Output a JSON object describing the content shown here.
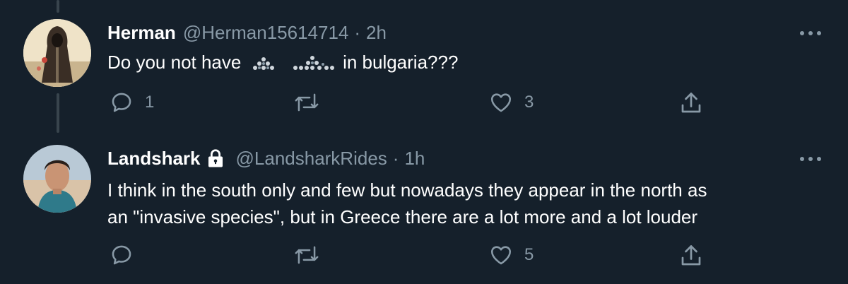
{
  "tweets": [
    {
      "name": "Herman",
      "handle": "@Herman15614714",
      "separator": "·",
      "time": "2h",
      "text_before": "Do you not have",
      "text_after": "in bulgaria???",
      "reply_count": "1",
      "retweet_count": "",
      "like_count": "3",
      "locked": false
    },
    {
      "name": "Landshark",
      "handle": "@LandsharkRides",
      "separator": "·",
      "time": "1h",
      "line1": "I think in the south only and few but nowadays they appear in the north as",
      "line2": "an \"invasive species\", but in Greece there are a lot more and a lot louder",
      "reply_count": "",
      "retweet_count": "",
      "like_count": "5",
      "locked": true
    }
  ],
  "colors": {
    "background": "#15202b",
    "secondary_text": "#8899a6",
    "thread_line": "#38444d"
  },
  "icons": [
    "reply-icon",
    "retweet-icon",
    "like-icon",
    "share-icon",
    "more-icon",
    "lock-icon"
  ]
}
